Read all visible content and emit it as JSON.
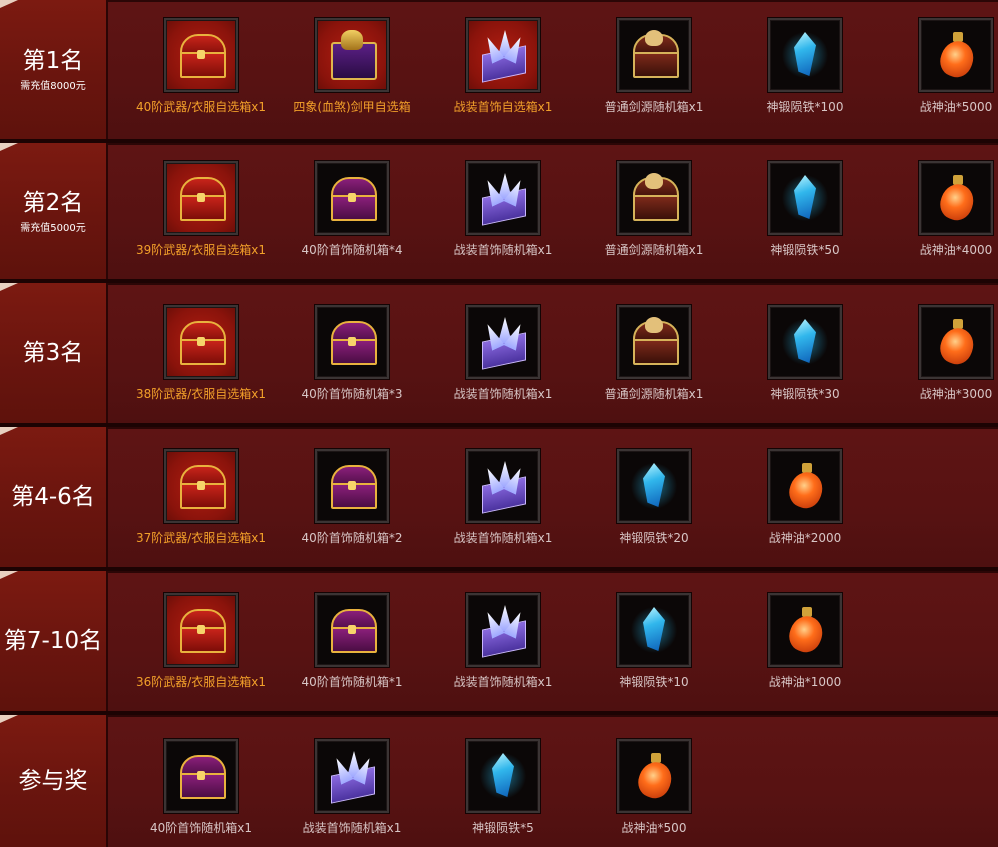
{
  "rows": [
    {
      "rank": "第1名",
      "requirement": "需充值8000元",
      "items": [
        {
          "label": "40阶武器/衣服自选箱x1",
          "icon": "red-treasure-chest-icon"
        },
        {
          "label": "四象(血煞)剑甲自选箱",
          "icon": "armor-chest-icon"
        },
        {
          "label": "战装首饰自选箱x1",
          "icon": "winged-purple-box-icon"
        },
        {
          "label": "普通剑源随机箱x1",
          "icon": "skull-treasure-chest-icon"
        },
        {
          "label": "神锻陨铁*100",
          "icon": "blue-crystal-icon"
        },
        {
          "label": "战神油*5000",
          "icon": "orange-potion-flask-icon"
        }
      ]
    },
    {
      "rank": "第2名",
      "requirement": "需充值5000元",
      "items": [
        {
          "label": "39阶武器/衣服自选箱x1",
          "icon": "red-treasure-chest-icon"
        },
        {
          "label": "40阶首饰随机箱*4",
          "icon": "purple-treasure-chest-icon"
        },
        {
          "label": "战装首饰随机箱x1",
          "icon": "winged-purple-box-icon"
        },
        {
          "label": "普通剑源随机箱x1",
          "icon": "skull-treasure-chest-icon"
        },
        {
          "label": "神锻陨铁*50",
          "icon": "blue-crystal-icon"
        },
        {
          "label": "战神油*4000",
          "icon": "orange-potion-flask-icon"
        }
      ]
    },
    {
      "rank": "第3名",
      "requirement": "",
      "items": [
        {
          "label": "38阶武器/衣服自选箱x1",
          "icon": "red-treasure-chest-icon"
        },
        {
          "label": "40阶首饰随机箱*3",
          "icon": "purple-treasure-chest-icon"
        },
        {
          "label": "战装首饰随机箱x1",
          "icon": "winged-purple-box-icon"
        },
        {
          "label": "普通剑源随机箱x1",
          "icon": "skull-treasure-chest-icon"
        },
        {
          "label": "神锻陨铁*30",
          "icon": "blue-crystal-icon"
        },
        {
          "label": "战神油*3000",
          "icon": "orange-potion-flask-icon"
        }
      ]
    },
    {
      "rank": "第4-6名",
      "requirement": "",
      "items": [
        {
          "label": "37阶武器/衣服自选箱x1",
          "icon": "red-treasure-chest-icon"
        },
        {
          "label": "40阶首饰随机箱*2",
          "icon": "purple-treasure-chest-icon"
        },
        {
          "label": "战装首饰随机箱x1",
          "icon": "winged-purple-box-icon"
        },
        {
          "label": "神锻陨铁*20",
          "icon": "blue-crystal-icon"
        },
        {
          "label": "战神油*2000",
          "icon": "orange-potion-flask-icon"
        }
      ]
    },
    {
      "rank": "第7-10名",
      "requirement": "",
      "items": [
        {
          "label": "36阶武器/衣服自选箱x1",
          "icon": "red-treasure-chest-icon"
        },
        {
          "label": "40阶首饰随机箱*1",
          "icon": "purple-treasure-chest-icon"
        },
        {
          "label": "战装首饰随机箱x1",
          "icon": "winged-purple-box-icon"
        },
        {
          "label": "神锻陨铁*10",
          "icon": "blue-crystal-icon"
        },
        {
          "label": "战神油*1000",
          "icon": "orange-potion-flask-icon"
        }
      ]
    },
    {
      "rank": "参与奖",
      "requirement": "",
      "items": [
        {
          "label": "40阶首饰随机箱x1",
          "icon": "purple-treasure-chest-icon"
        },
        {
          "label": "战装首饰随机箱x1",
          "icon": "winged-purple-box-icon"
        },
        {
          "label": "神锻陨铁*5",
          "icon": "blue-crystal-icon"
        },
        {
          "label": "战神油*500",
          "icon": "orange-potion-flask-icon"
        }
      ]
    }
  ],
  "colors": {
    "gold_label": "#f2a02a",
    "normal_label": "#d8c6c6",
    "rank_panel": "#7c1a11",
    "content_panel": "#5e1414"
  }
}
